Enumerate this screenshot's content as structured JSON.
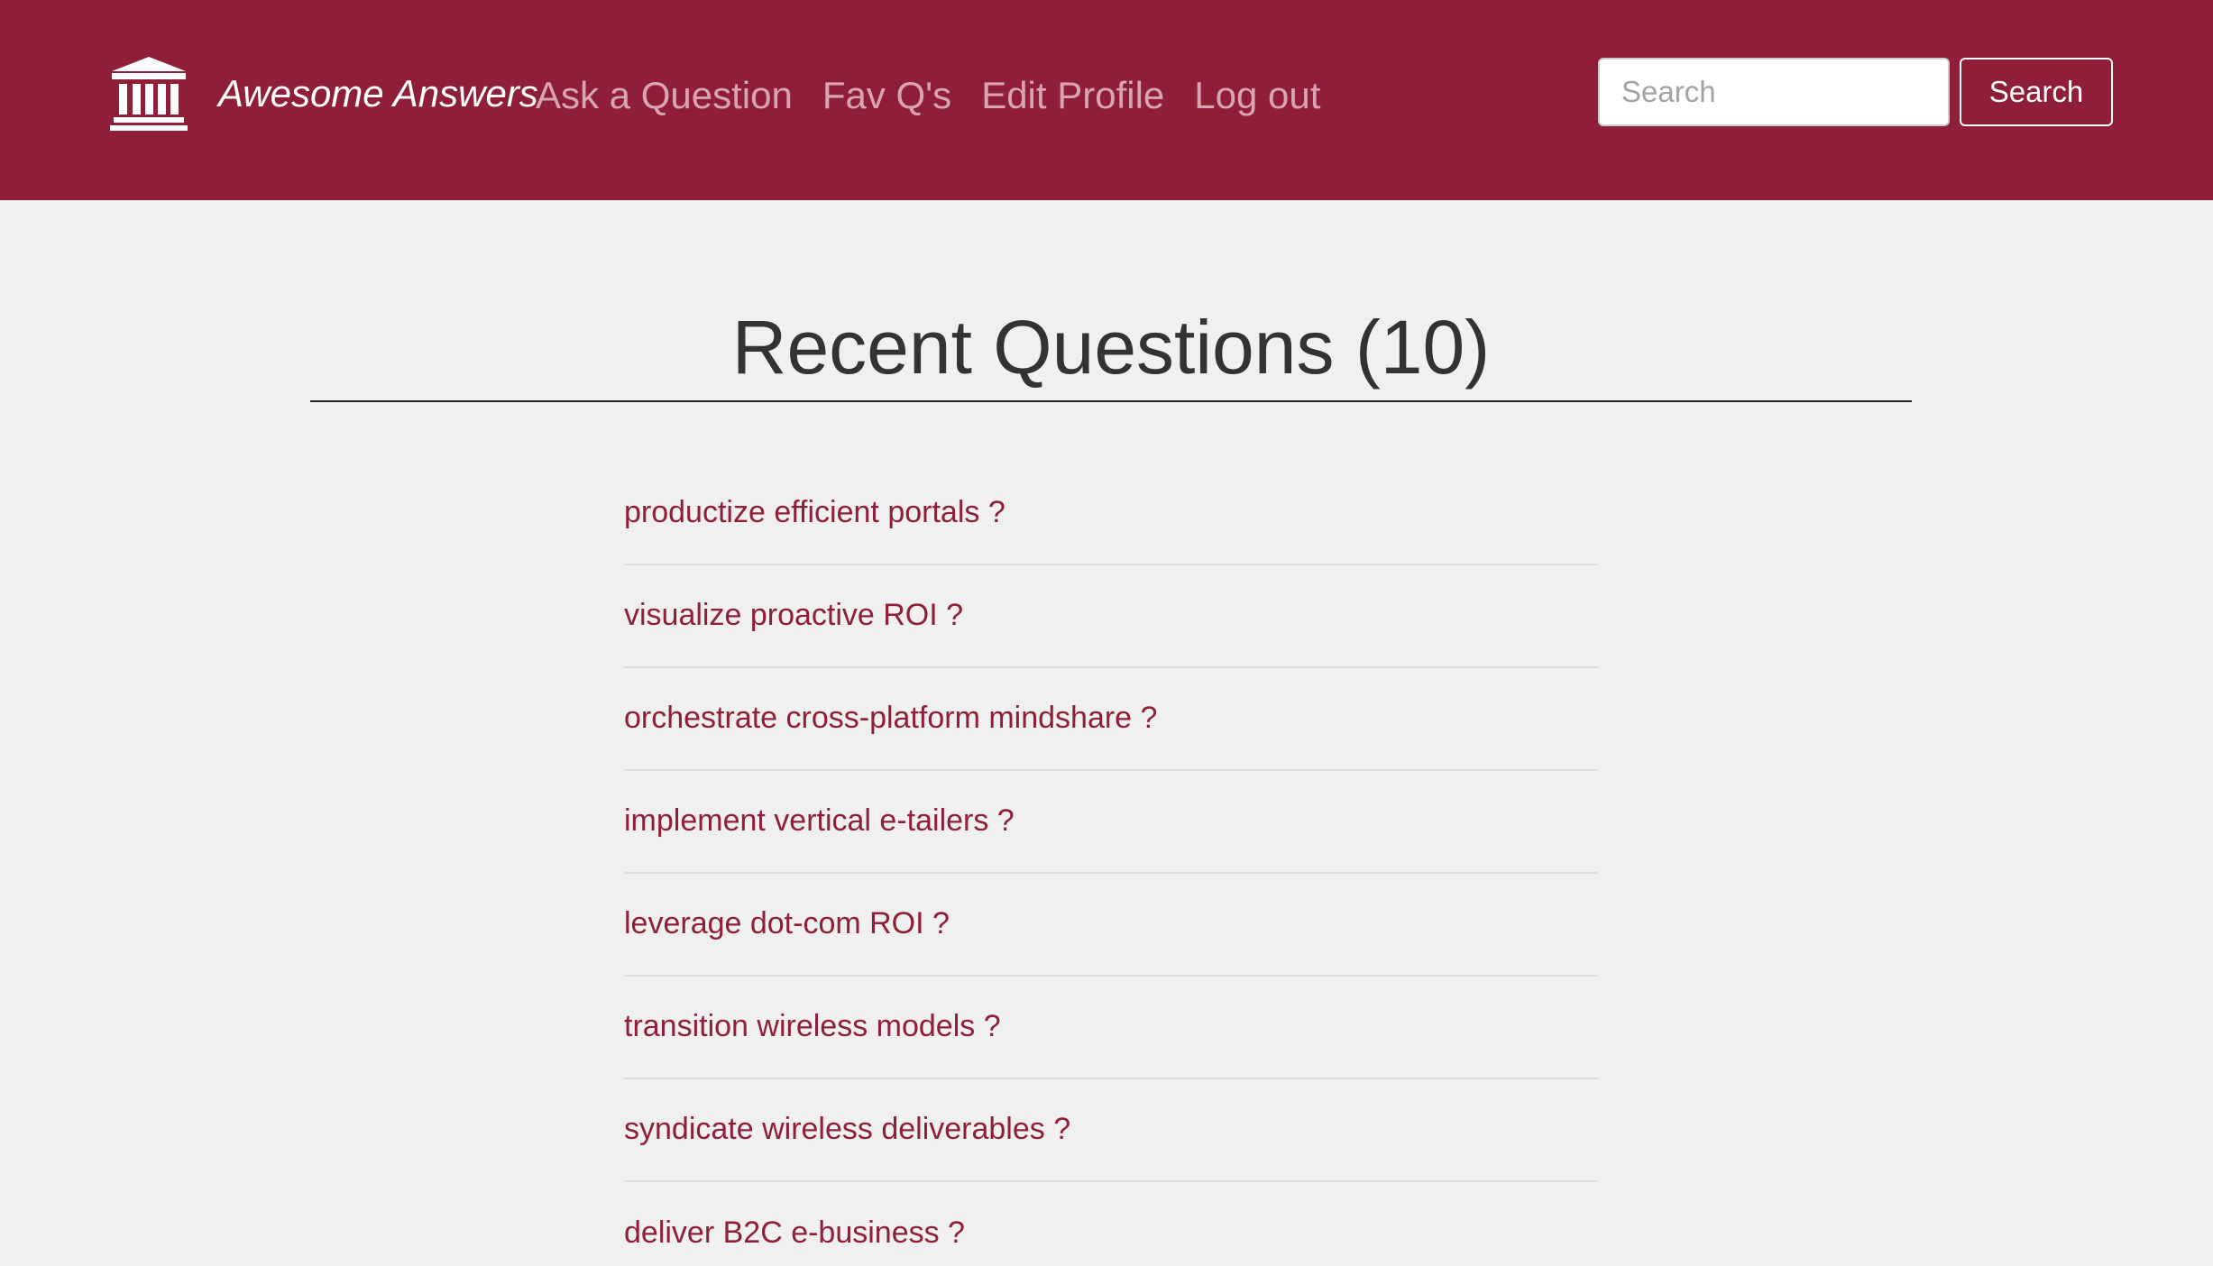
{
  "navbar": {
    "brand": {
      "name": "Awesome Answers",
      "icon": "institution-icon"
    },
    "links": [
      {
        "label": "Ask a Question"
      },
      {
        "label": "Fav Q's"
      },
      {
        "label": "Edit Profile"
      },
      {
        "label": "Log out"
      }
    ],
    "search": {
      "placeholder": "Search",
      "value": "",
      "button_label": "Search"
    }
  },
  "main": {
    "title": "Recent Questions (10)",
    "questions": [
      {
        "title": "productize efficient portals ?"
      },
      {
        "title": "visualize proactive ROI ?"
      },
      {
        "title": "orchestrate cross-platform mindshare ?"
      },
      {
        "title": "implement vertical e-tailers ?"
      },
      {
        "title": "leverage dot-com ROI ?"
      },
      {
        "title": "transition wireless models ?"
      },
      {
        "title": "syndicate wireless deliverables ?"
      },
      {
        "title": "deliver B2C e-business ?"
      }
    ]
  },
  "colors": {
    "brand": "#8f1f39",
    "nav_link": "#d9a4b1",
    "background": "#f0f0f0",
    "heading": "#333333"
  }
}
